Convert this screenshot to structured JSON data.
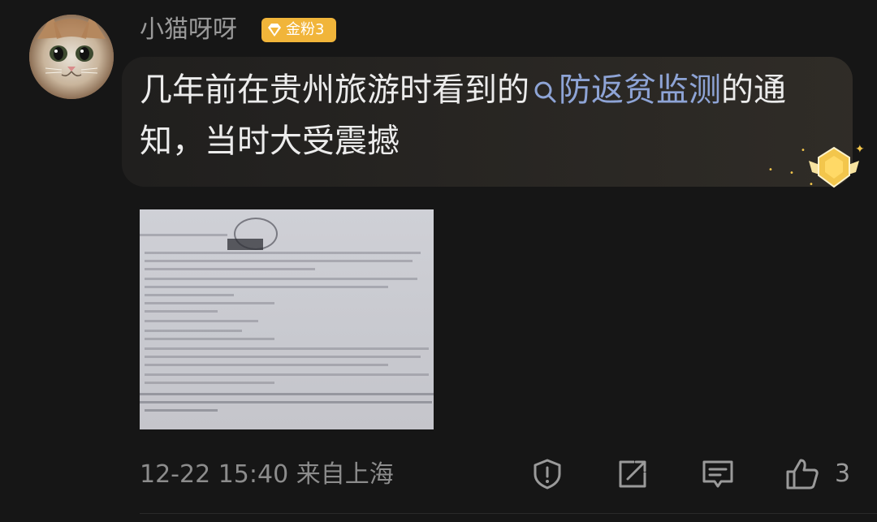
{
  "comment": {
    "username": "小猫呀呀",
    "badge_label": "金粉3",
    "text_before": "几年前在贵州旅游时看到的",
    "link_text": "防返贫监测",
    "text_after": "的通知，当时大受震撼",
    "timestamp": "12-22 15:40",
    "location": "来自上海",
    "like_count": "3"
  },
  "icons": {
    "search": "search-icon",
    "report": "report-icon",
    "share": "share-icon",
    "reply": "comment-icon",
    "like": "thumbs-up-icon",
    "badge": "fan-badge-icon",
    "medal": "medal-icon"
  },
  "colors": {
    "background": "#161616",
    "link": "#8ea4d6",
    "badge": "#f1b53a",
    "secondary_text": "#8c8c8c"
  }
}
